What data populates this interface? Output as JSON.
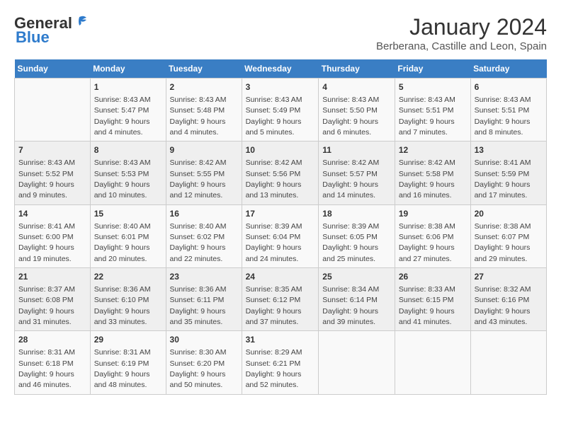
{
  "header": {
    "logo_general": "General",
    "logo_blue": "Blue",
    "month_title": "January 2024",
    "subtitle": "Berberana, Castille and Leon, Spain"
  },
  "days_of_week": [
    "Sunday",
    "Monday",
    "Tuesday",
    "Wednesday",
    "Thursday",
    "Friday",
    "Saturday"
  ],
  "weeks": [
    [
      {
        "day": "",
        "sunrise": "",
        "sunset": "",
        "daylight": ""
      },
      {
        "day": "1",
        "sunrise": "Sunrise: 8:43 AM",
        "sunset": "Sunset: 5:47 PM",
        "daylight": "Daylight: 9 hours and 4 minutes."
      },
      {
        "day": "2",
        "sunrise": "Sunrise: 8:43 AM",
        "sunset": "Sunset: 5:48 PM",
        "daylight": "Daylight: 9 hours and 4 minutes."
      },
      {
        "day": "3",
        "sunrise": "Sunrise: 8:43 AM",
        "sunset": "Sunset: 5:49 PM",
        "daylight": "Daylight: 9 hours and 5 minutes."
      },
      {
        "day": "4",
        "sunrise": "Sunrise: 8:43 AM",
        "sunset": "Sunset: 5:50 PM",
        "daylight": "Daylight: 9 hours and 6 minutes."
      },
      {
        "day": "5",
        "sunrise": "Sunrise: 8:43 AM",
        "sunset": "Sunset: 5:51 PM",
        "daylight": "Daylight: 9 hours and 7 minutes."
      },
      {
        "day": "6",
        "sunrise": "Sunrise: 8:43 AM",
        "sunset": "Sunset: 5:51 PM",
        "daylight": "Daylight: 9 hours and 8 minutes."
      }
    ],
    [
      {
        "day": "7",
        "sunrise": "Sunrise: 8:43 AM",
        "sunset": "Sunset: 5:52 PM",
        "daylight": "Daylight: 9 hours and 9 minutes."
      },
      {
        "day": "8",
        "sunrise": "Sunrise: 8:43 AM",
        "sunset": "Sunset: 5:53 PM",
        "daylight": "Daylight: 9 hours and 10 minutes."
      },
      {
        "day": "9",
        "sunrise": "Sunrise: 8:42 AM",
        "sunset": "Sunset: 5:55 PM",
        "daylight": "Daylight: 9 hours and 12 minutes."
      },
      {
        "day": "10",
        "sunrise": "Sunrise: 8:42 AM",
        "sunset": "Sunset: 5:56 PM",
        "daylight": "Daylight: 9 hours and 13 minutes."
      },
      {
        "day": "11",
        "sunrise": "Sunrise: 8:42 AM",
        "sunset": "Sunset: 5:57 PM",
        "daylight": "Daylight: 9 hours and 14 minutes."
      },
      {
        "day": "12",
        "sunrise": "Sunrise: 8:42 AM",
        "sunset": "Sunset: 5:58 PM",
        "daylight": "Daylight: 9 hours and 16 minutes."
      },
      {
        "day": "13",
        "sunrise": "Sunrise: 8:41 AM",
        "sunset": "Sunset: 5:59 PM",
        "daylight": "Daylight: 9 hours and 17 minutes."
      }
    ],
    [
      {
        "day": "14",
        "sunrise": "Sunrise: 8:41 AM",
        "sunset": "Sunset: 6:00 PM",
        "daylight": "Daylight: 9 hours and 19 minutes."
      },
      {
        "day": "15",
        "sunrise": "Sunrise: 8:40 AM",
        "sunset": "Sunset: 6:01 PM",
        "daylight": "Daylight: 9 hours and 20 minutes."
      },
      {
        "day": "16",
        "sunrise": "Sunrise: 8:40 AM",
        "sunset": "Sunset: 6:02 PM",
        "daylight": "Daylight: 9 hours and 22 minutes."
      },
      {
        "day": "17",
        "sunrise": "Sunrise: 8:39 AM",
        "sunset": "Sunset: 6:04 PM",
        "daylight": "Daylight: 9 hours and 24 minutes."
      },
      {
        "day": "18",
        "sunrise": "Sunrise: 8:39 AM",
        "sunset": "Sunset: 6:05 PM",
        "daylight": "Daylight: 9 hours and 25 minutes."
      },
      {
        "day": "19",
        "sunrise": "Sunrise: 8:38 AM",
        "sunset": "Sunset: 6:06 PM",
        "daylight": "Daylight: 9 hours and 27 minutes."
      },
      {
        "day": "20",
        "sunrise": "Sunrise: 8:38 AM",
        "sunset": "Sunset: 6:07 PM",
        "daylight": "Daylight: 9 hours and 29 minutes."
      }
    ],
    [
      {
        "day": "21",
        "sunrise": "Sunrise: 8:37 AM",
        "sunset": "Sunset: 6:08 PM",
        "daylight": "Daylight: 9 hours and 31 minutes."
      },
      {
        "day": "22",
        "sunrise": "Sunrise: 8:36 AM",
        "sunset": "Sunset: 6:10 PM",
        "daylight": "Daylight: 9 hours and 33 minutes."
      },
      {
        "day": "23",
        "sunrise": "Sunrise: 8:36 AM",
        "sunset": "Sunset: 6:11 PM",
        "daylight": "Daylight: 9 hours and 35 minutes."
      },
      {
        "day": "24",
        "sunrise": "Sunrise: 8:35 AM",
        "sunset": "Sunset: 6:12 PM",
        "daylight": "Daylight: 9 hours and 37 minutes."
      },
      {
        "day": "25",
        "sunrise": "Sunrise: 8:34 AM",
        "sunset": "Sunset: 6:14 PM",
        "daylight": "Daylight: 9 hours and 39 minutes."
      },
      {
        "day": "26",
        "sunrise": "Sunrise: 8:33 AM",
        "sunset": "Sunset: 6:15 PM",
        "daylight": "Daylight: 9 hours and 41 minutes."
      },
      {
        "day": "27",
        "sunrise": "Sunrise: 8:32 AM",
        "sunset": "Sunset: 6:16 PM",
        "daylight": "Daylight: 9 hours and 43 minutes."
      }
    ],
    [
      {
        "day": "28",
        "sunrise": "Sunrise: 8:31 AM",
        "sunset": "Sunset: 6:18 PM",
        "daylight": "Daylight: 9 hours and 46 minutes."
      },
      {
        "day": "29",
        "sunrise": "Sunrise: 8:31 AM",
        "sunset": "Sunset: 6:19 PM",
        "daylight": "Daylight: 9 hours and 48 minutes."
      },
      {
        "day": "30",
        "sunrise": "Sunrise: 8:30 AM",
        "sunset": "Sunset: 6:20 PM",
        "daylight": "Daylight: 9 hours and 50 minutes."
      },
      {
        "day": "31",
        "sunrise": "Sunrise: 8:29 AM",
        "sunset": "Sunset: 6:21 PM",
        "daylight": "Daylight: 9 hours and 52 minutes."
      },
      {
        "day": "",
        "sunrise": "",
        "sunset": "",
        "daylight": ""
      },
      {
        "day": "",
        "sunrise": "",
        "sunset": "",
        "daylight": ""
      },
      {
        "day": "",
        "sunrise": "",
        "sunset": "",
        "daylight": ""
      }
    ]
  ]
}
